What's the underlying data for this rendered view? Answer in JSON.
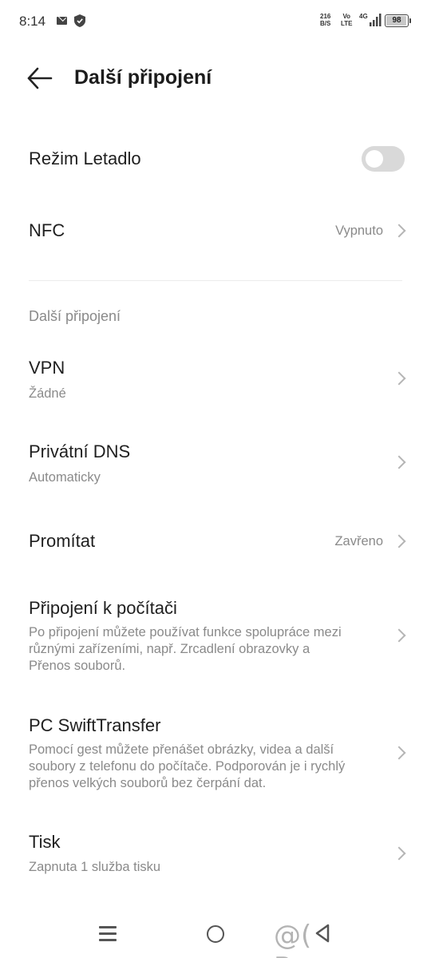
{
  "status_bar": {
    "time": "8:14",
    "speed_value": "216",
    "speed_unit": "B/S",
    "volte_top": "Vo",
    "volte_bottom": "LTE",
    "network": "4G",
    "battery": "98",
    "battery_level": 0.98
  },
  "header": {
    "title": "Další připojení"
  },
  "airplane": {
    "label": "Režim Letadlo",
    "enabled": false
  },
  "nfc": {
    "label": "NFC",
    "value": "Vypnuto"
  },
  "section": {
    "title": "Další připojení"
  },
  "vpn": {
    "label": "VPN",
    "sub": "Žádné"
  },
  "dns": {
    "label": "Privátní DNS",
    "sub": "Automaticky"
  },
  "cast": {
    "label": "Promítat",
    "value": "Zavřeno"
  },
  "pc_connect": {
    "label": "Připojení k počítači",
    "sub": "Po připojení můžete používat funkce spolupráce mezi různými zařízeními, např. Zrcadlení obrazovky a Přenos souborů."
  },
  "swift": {
    "label": "PC SwiftTransfer",
    "sub": "Pomocí gest můžete přenášet obrázky, videa a další soubory z telefonu do počítače. Podporován je i rychlý přenos velkých souborů bez čerpání dat."
  },
  "print": {
    "label": "Tisk",
    "sub": "Zapnuta 1 služba tisku"
  },
  "watermark": "@( Bazos.cz",
  "colors": {
    "text": "#1f1f1f",
    "secondary": "#8a8a8a",
    "toggle_off": "#d9d9d9"
  }
}
